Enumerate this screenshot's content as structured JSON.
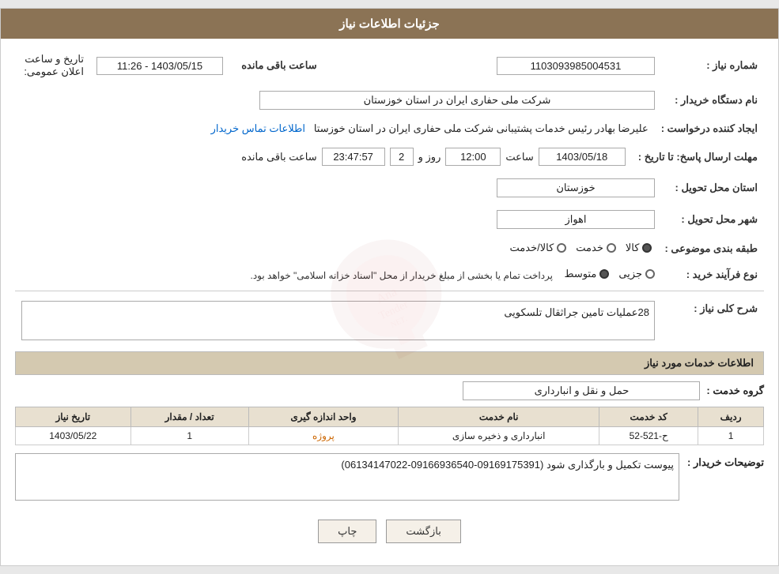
{
  "header": {
    "title": "جزئیات اطلاعات نیاز"
  },
  "fields": {
    "shomara_niaz_label": "شماره نیاز :",
    "shomara_niaz_value": "1103093985004531",
    "nam_dastgah_label": "نام دستگاه خریدار :",
    "nam_dastgah_value": "شرکت ملی حفاری ایران در استان خوزستان",
    "ejad_label": "ایجاد کننده درخواست :",
    "ejad_value": "علیرضا بهادر رئیس خدمات پشتیبانی شرکت ملی حفاری ایران در استان خوزستا",
    "ejad_link": "اطلاعات تماس خریدار",
    "mohlat_label": "مهلت ارسال پاسخ: تا تاریخ :",
    "date_value": "1403/05/18",
    "saaat_label": "ساعت",
    "saaat_value": "12:00",
    "rooz_label": "روز و",
    "rooz_value": "2",
    "countdown_value": "23:47:57",
    "countdown_label": "ساعت باقی مانده",
    "ostan_label": "استان محل تحویل :",
    "ostan_value": "خوزستان",
    "shahr_label": "شهر محل تحویل :",
    "shahr_value": "اهواز",
    "tabaqe_label": "طبقه بندی موضوعی :",
    "tabaqe_options": [
      "کالا",
      "خدمت",
      "کالا/خدمت"
    ],
    "tabaqe_selected": "کالا",
    "nooe_farayand_label": "نوع فرآیند خرید :",
    "nooe_options": [
      "جزیی",
      "متوسط"
    ],
    "nooe_text": "پرداخت تمام یا بخشی از مبلغ خریدار از محل \"اسناد خزانه اسلامی\" خواهد بود.",
    "sharh_label": "شرح کلی نیاز :",
    "sharh_value": "28عملیات تامین جراثقال تلسکویی",
    "service_info_title": "اطلاعات خدمات مورد نیاز",
    "group_label": "گروه خدمت :",
    "group_value": "حمل و نقل و انبارداری",
    "table": {
      "headers": [
        "ردیف",
        "کد خدمت",
        "نام خدمت",
        "واحد اندازه گیری",
        "تعداد / مقدار",
        "تاریخ نیاز"
      ],
      "rows": [
        {
          "radif": "1",
          "kod": "ح-521-52",
          "name": "انبارداری و ذخیره سازی",
          "unit": "پروژه",
          "count": "1",
          "date": "1403/05/22"
        }
      ]
    },
    "buyer_notes_label": "توضیحات خریدار :",
    "buyer_notes_value": "پیوست تکمیل و بارگذاری شود (09169175391-09166936540-06134147022)",
    "btn_print": "چاپ",
    "btn_back": "بازگشت"
  }
}
